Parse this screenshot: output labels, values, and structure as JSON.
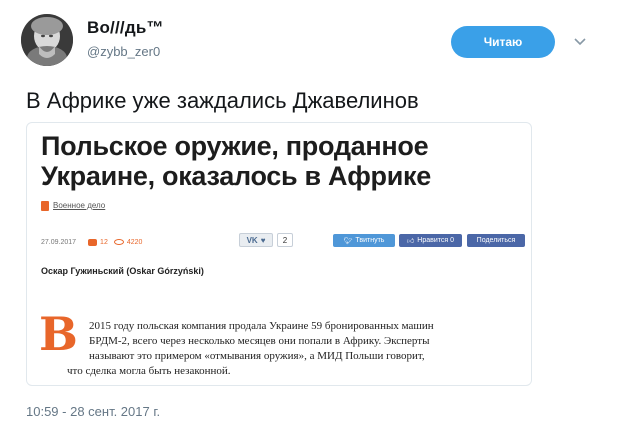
{
  "author": {
    "display_name": "Во///дь™",
    "handle": "@zybb_zer0"
  },
  "follow_button": {
    "label": "Читаю"
  },
  "tweet": {
    "text": "В Африке уже заждались Джавелинов",
    "timestamp": "10:59 - 28 сент. 2017 г."
  },
  "article": {
    "headline_line1": "Польское оружие, проданное",
    "headline_line2": "Украине, оказалось в Африке",
    "section": "Военное дело",
    "date": "27.09.2017",
    "comments": "12",
    "views": "4220",
    "share_vk_label": "VK",
    "share_vk_count": "2",
    "tweet_button": "Твитнуть",
    "like_button": "Нравится 0",
    "share_button": "Поделиться",
    "byline": "Оскар Гужиньский (Oskar Górzyński)",
    "dropcap": "В",
    "body_lines": [
      "2015 году польская компания продала Украине 59 бронированных машин",
      "БРДМ-2, всего через несколько месяцев они попали в Африку. Эксперты",
      "называют это примером «отмывания оружия», а МИД Польши говорит,",
      "что сделка могла быть незаконной."
    ]
  },
  "colors": {
    "follow_blue": "#3aa0e8",
    "accent_orange": "#e8662a",
    "muted_gray": "#657786"
  },
  "icons": {
    "chevron": "chevron-down-icon",
    "avatar": "avatar"
  }
}
